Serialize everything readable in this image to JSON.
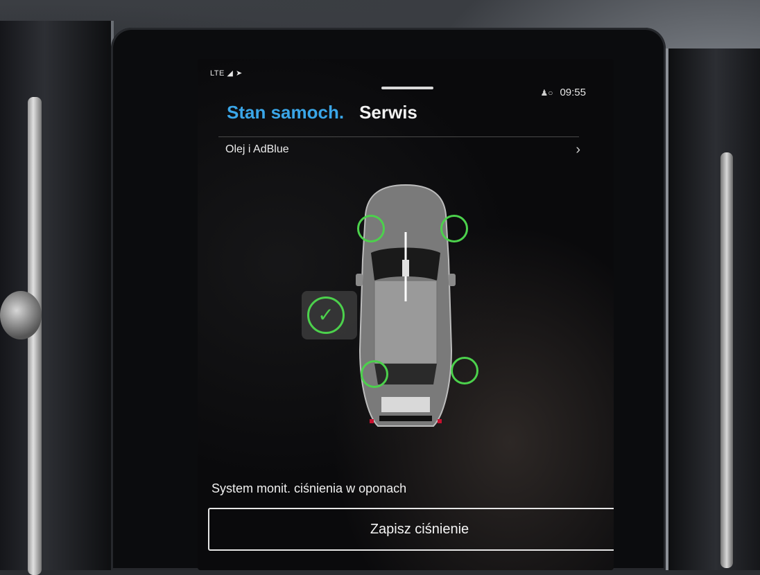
{
  "statusbar": {
    "network": "LTE",
    "time": "09:55"
  },
  "tabs": [
    {
      "label": "Stan samoch.",
      "active": true
    },
    {
      "label": "Serwis",
      "active": false
    }
  ],
  "oil_row": {
    "label": "Olej i AdBlue"
  },
  "tpms": {
    "status": "ok",
    "label": "System monit. ciśnienia w oponach",
    "button_label": "Zapisz ciśnienie"
  },
  "colors": {
    "accent": "#3aa6e8",
    "ok_green": "#4cd14c"
  }
}
